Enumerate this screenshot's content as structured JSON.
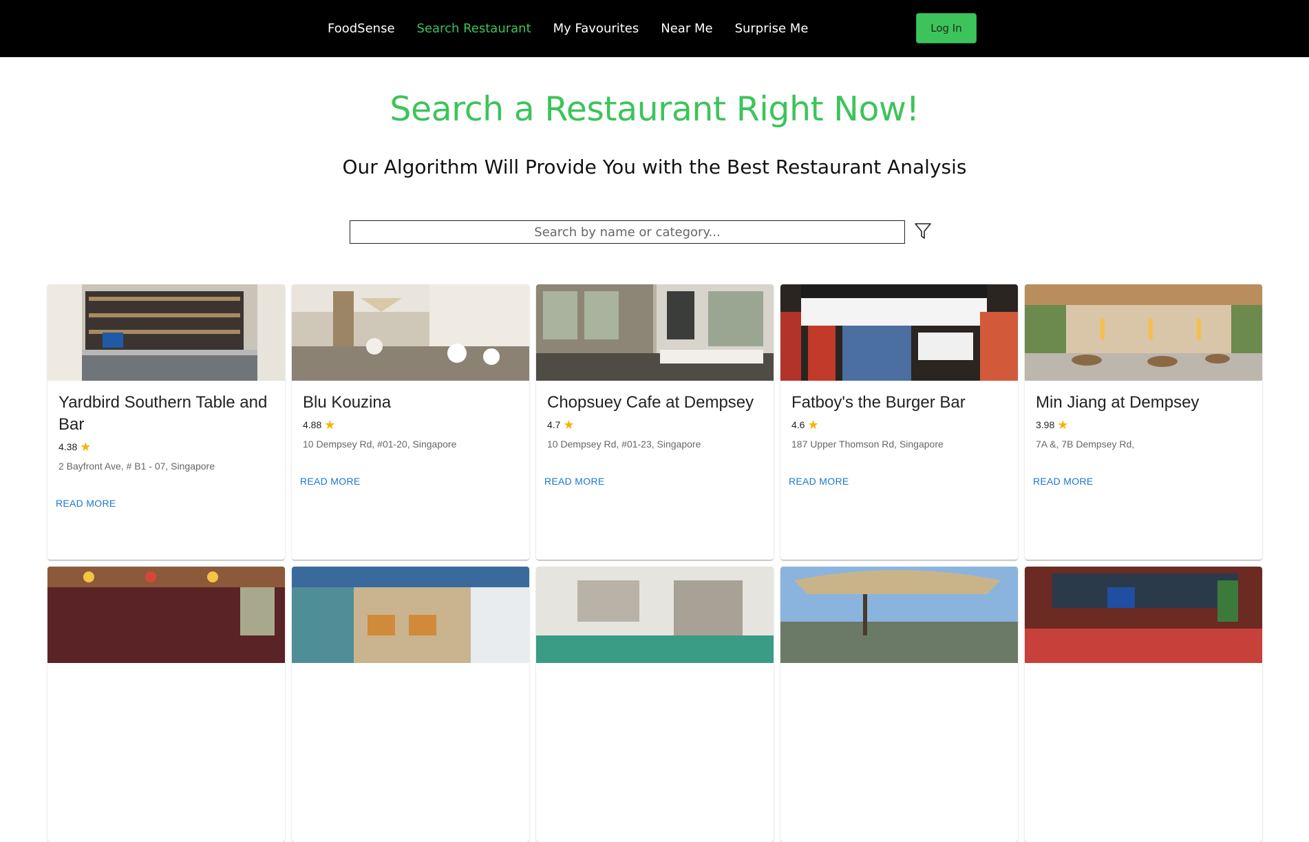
{
  "navbar": {
    "brand": "FoodSense",
    "links": [
      {
        "label": "Search Restaurant",
        "active": true
      },
      {
        "label": "My Favourites",
        "active": false
      },
      {
        "label": "Near Me",
        "active": false
      },
      {
        "label": "Surprise Me",
        "active": false
      }
    ],
    "login_label": "Log In"
  },
  "hero": {
    "title": "Search a Restaurant Right Now!",
    "subtitle": "Our Algorithm Will Provide You with the Best Restaurant Analysis"
  },
  "search": {
    "placeholder": "Search by name or category...",
    "value": "",
    "filter_icon": "filter-icon"
  },
  "cards": [
    {
      "name": "Yardbird Southern Table and Bar",
      "rating": "4.38",
      "address": "2 Bayfront Ave, # B1 - 07, Singapore",
      "cta": "READ MORE"
    },
    {
      "name": "Blu Kouzina",
      "rating": "4.88",
      "address": "10 Dempsey Rd, #01-20, Singapore",
      "cta": "READ MORE"
    },
    {
      "name": "Chopsuey Cafe at Dempsey",
      "rating": "4.7",
      "address": "10 Dempsey Rd, #01-23, Singapore",
      "cta": "READ MORE"
    },
    {
      "name": "Fatboy's the Burger Bar",
      "rating": "4.6",
      "address": "187 Upper Thomson Rd, Singapore",
      "cta": "READ MORE"
    },
    {
      "name": "Min Jiang at Dempsey",
      "rating": "3.98",
      "address": "7A &, 7B Dempsey Rd,",
      "cta": "READ MORE"
    }
  ],
  "colors": {
    "accent": "#3cc45b",
    "navbar_bg": "#000000",
    "link": "#1976d2",
    "star": "#f5b400"
  }
}
